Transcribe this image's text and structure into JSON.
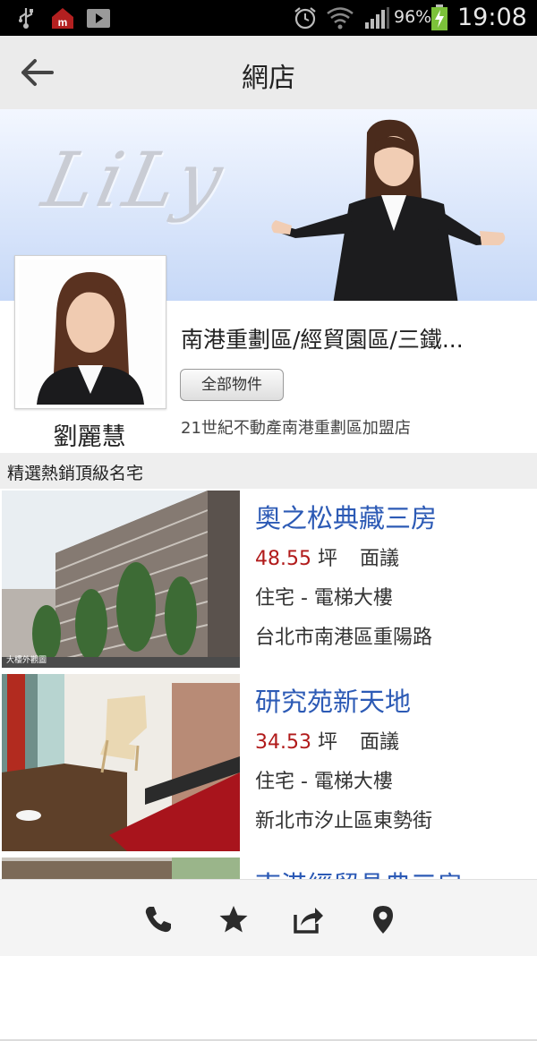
{
  "status_bar": {
    "battery_percent": "96%",
    "time": "19:08",
    "icons": [
      "usb-icon",
      "app-notification-icon",
      "play-store-icon",
      "alarm-icon",
      "wifi-icon",
      "signal-icon",
      "battery-charging-icon"
    ]
  },
  "header": {
    "back_icon": "arrow-left-icon",
    "title": "網店"
  },
  "banner": {
    "logo_text": "LiLy"
  },
  "agent": {
    "name": "劉麗慧",
    "store_title": "南港重劃區/經貿園區/三鐵...",
    "all_listings_button": "全部物件",
    "store_subtitle": "21世紀不動產南港重劃區加盟店"
  },
  "section": {
    "title": "精選熱銷頂級名宅"
  },
  "listings": [
    {
      "title": "奧之松典藏三房",
      "size_value": "48.55",
      "size_unit": "坪",
      "price": "面議",
      "type": "住宅 - 電梯大樓",
      "address": "台北市南港區重陽路",
      "photo_caption": "大樓外觀圖"
    },
    {
      "title": "研究苑新天地",
      "size_value": "34.53",
      "size_unit": "坪",
      "price": "面議",
      "type": "住宅 - 電梯大樓",
      "address": "新北市汐止區東勢街"
    },
    {
      "title": "南港經貿晶典三房"
    }
  ],
  "bottom_bar": {
    "icons": [
      "phone-icon",
      "star-icon",
      "share-icon",
      "location-pin-icon"
    ]
  },
  "colors": {
    "title_blue": "#2c5ab5",
    "size_red": "#b11a1a",
    "action_bar_bg": "#ebebeb"
  }
}
